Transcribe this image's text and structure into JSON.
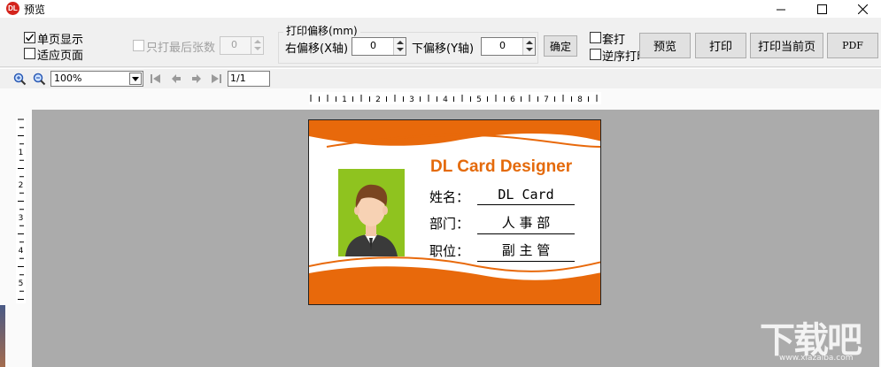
{
  "window": {
    "title": "预览",
    "logo_text": "DL"
  },
  "options": {
    "single_page_label": "单页显示",
    "single_page_checked": true,
    "fit_page_label": "适应页面",
    "fit_page_checked": false,
    "print_last_label": "只打最后张数",
    "print_last_value": "0",
    "overlay_label": "套打",
    "reverse_label": "逆序打印"
  },
  "offset": {
    "group_label": "打印偏移(mm)",
    "right_label": "右偏移(X轴)",
    "right_value": "0",
    "down_label": "下偏移(Y轴)",
    "down_value": "0",
    "confirm_label": "确定"
  },
  "buttons": {
    "preview": "预览",
    "print": "打印",
    "print_current": "打印当前页",
    "pdf": "PDF"
  },
  "nav": {
    "zoom": "100%",
    "page": "1/1"
  },
  "ruler": {
    "h_labels": [
      "1",
      "2",
      "3",
      "4",
      "5",
      "6",
      "7",
      "8"
    ],
    "v_labels": [
      "1",
      "2",
      "3",
      "4",
      "5"
    ]
  },
  "card": {
    "title": "DL Card Designer",
    "fields": [
      {
        "label": "姓名：",
        "value": "DL Card"
      },
      {
        "label": "部门：",
        "value": "人 事 部"
      },
      {
        "label": "职位：",
        "value": "副 主 管"
      }
    ],
    "accent_color": "#e8690b",
    "photo_bg": "#8fc31f"
  },
  "watermark": {
    "text": "下载吧",
    "sub": "www.xiazaiba.com"
  }
}
